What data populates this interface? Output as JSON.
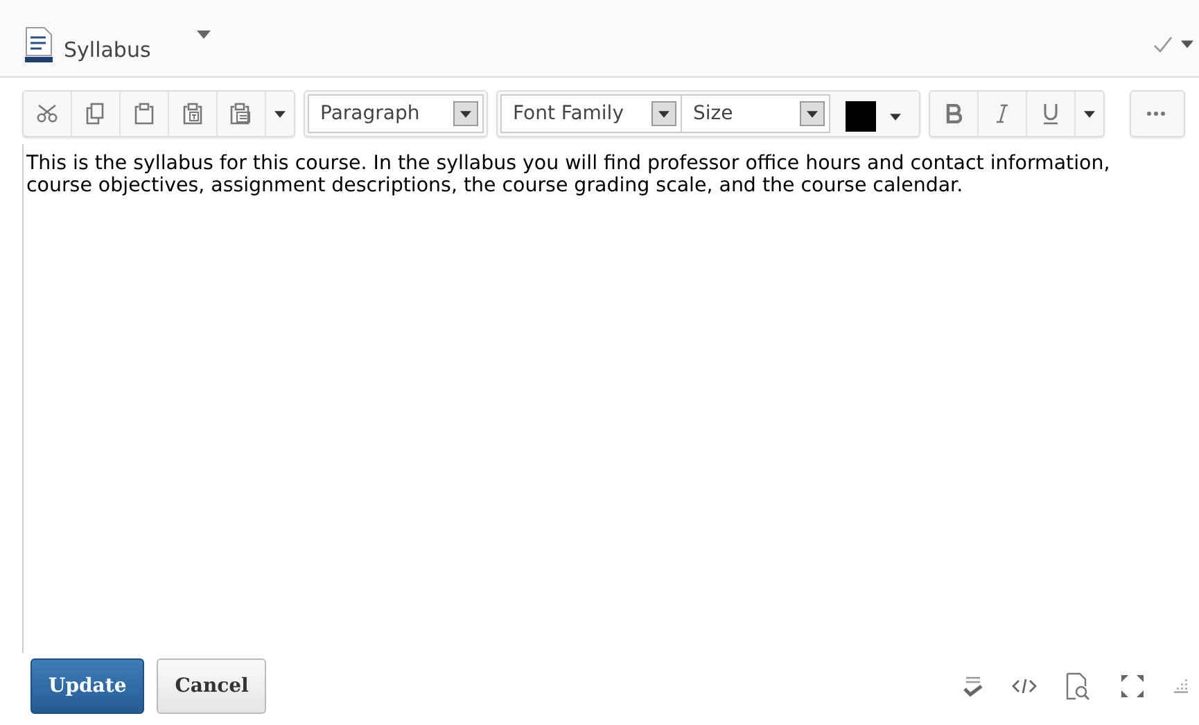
{
  "header": {
    "title": "Syllabus"
  },
  "toolbar": {
    "format": "Paragraph",
    "font_family": "Font Family",
    "size": "Size"
  },
  "editor": {
    "text": "This is the syllabus for this course. In the syllabus you will find professor office hours and contact information, course objectives, assignment descriptions, the course grading scale, and the course calendar."
  },
  "buttons": [
    {
      "label": "Update",
      "kind": "primary"
    },
    {
      "label": "Cancel",
      "kind": "secondary"
    }
  ]
}
